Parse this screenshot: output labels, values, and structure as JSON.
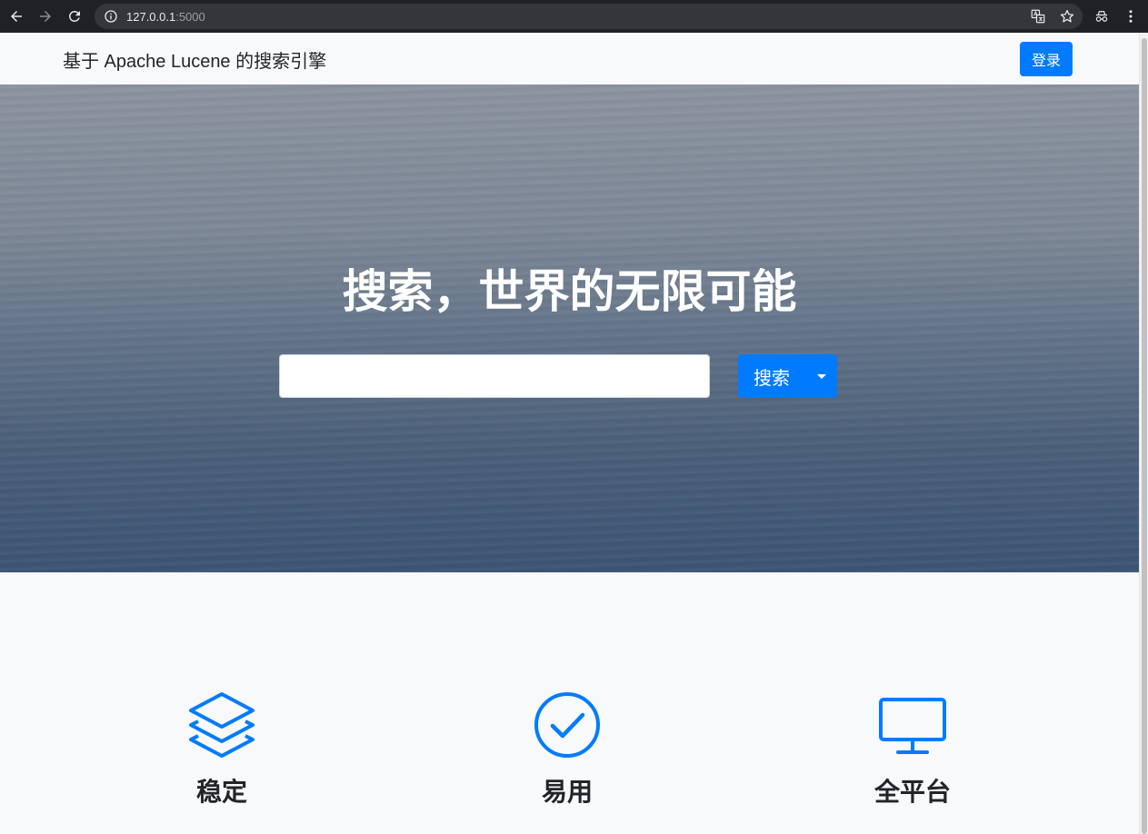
{
  "browser": {
    "url_host": "127.0.0.1",
    "url_port": ":5000",
    "icons": {
      "back": "arrow-left-icon",
      "forward": "arrow-right-icon",
      "reload": "reload-icon",
      "site_info": "info-icon",
      "translate": "translate-icon",
      "bookmark": "star-icon",
      "incognito": "incognito-icon",
      "menu": "kebab-menu-icon"
    }
  },
  "navbar": {
    "brand": "基于 Apache Lucene 的搜索引擎",
    "login_label": "登录"
  },
  "hero": {
    "title": "搜索，世界的无限可能",
    "search_value": "",
    "search_button_label": "搜索"
  },
  "features": [
    {
      "label": "稳定",
      "icon": "layers-icon"
    },
    {
      "label": "易用",
      "icon": "check-circle-icon"
    },
    {
      "label": "全平台",
      "icon": "monitor-icon"
    }
  ],
  "colors": {
    "primary": "#007bff",
    "page_bg": "#f8f9fa",
    "text": "#212529",
    "chrome_bg": "#202124"
  }
}
